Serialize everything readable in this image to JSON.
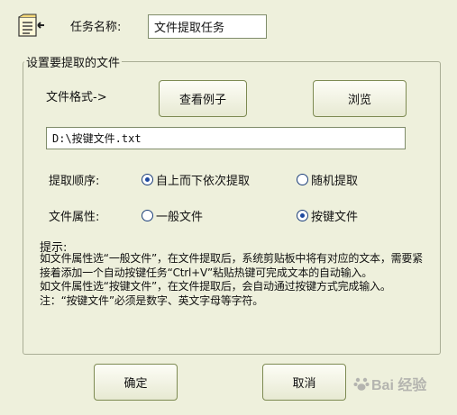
{
  "header": {
    "task_label": "任务名称:",
    "task_value": "文件提取任务"
  },
  "group": {
    "title": "设置要提取的文件",
    "format_label": "文件格式->",
    "example_button": "查看例子",
    "browse_button": "浏览",
    "path_value": "D:\\按键文件.txt",
    "order_label": "提取顺序:",
    "order_options": [
      {
        "label": "自上而下依次提取",
        "selected": true
      },
      {
        "label": "随机提取",
        "selected": false
      }
    ],
    "attr_label": "文件属性:",
    "attr_options": [
      {
        "label": "一般文件",
        "selected": false
      },
      {
        "label": "按键文件",
        "selected": true
      }
    ],
    "hint_title": "提示:",
    "hint_text": "如文件属性选“一般文件”，在文件提取后，系统剪贴板中将有对应的文本，需要紧接着添加一个自动按键任务“Ctrl+V”粘贴热键可完成文本的自动输入。\n如文件属性选“按键文件”，在文件提取后，会自动通过按键方式完成输入。\n注：“按键文件”必须是数字、英文字母等字符。"
  },
  "footer": {
    "ok_button": "确定",
    "cancel_button": "取消"
  },
  "watermark": {
    "text": "Bai 经验"
  },
  "colors": {
    "background": "#eef0dc",
    "button_border": "#7d8a52",
    "radio_dot": "#1e4aa0"
  }
}
